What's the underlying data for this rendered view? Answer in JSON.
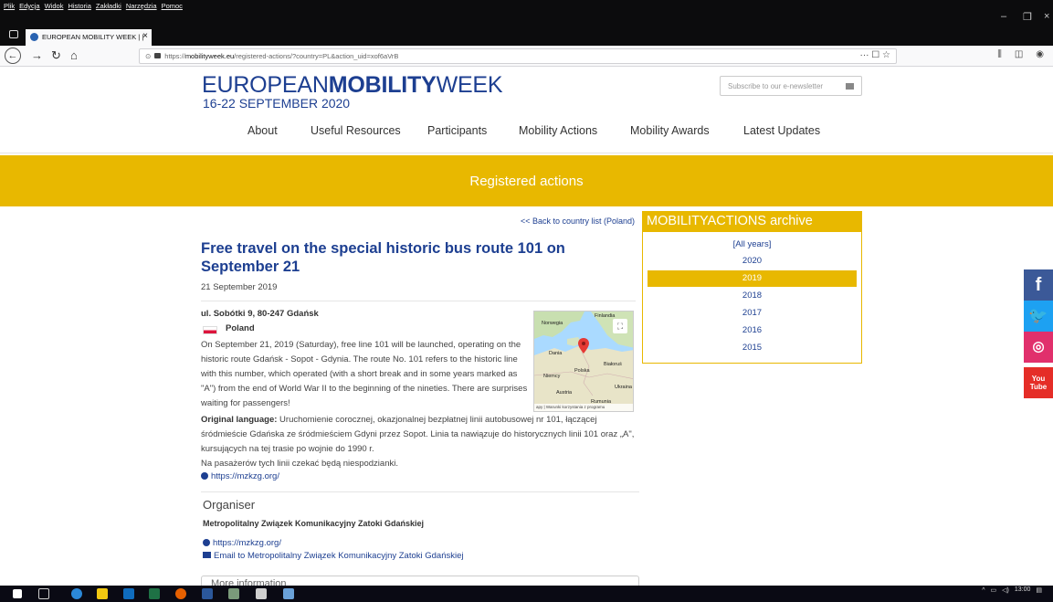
{
  "browser": {
    "menus": [
      "Plik",
      "Edycja",
      "Widok",
      "Historia",
      "Zakładki",
      "Narzędzia",
      "Pomoc"
    ],
    "tab_title": "EUROPEAN MOBILITY WEEK | |",
    "tab_close": "×",
    "url_prefix": "https://",
    "url_domain": "mobilityweek.eu",
    "url_path": "/registered-actions/?country=PL&action_uid=xof6aVrB",
    "url_actions": "··· ☐ ☆"
  },
  "site": {
    "logo_light": "EUROPEAN",
    "logo_bold": "MOBILITY",
    "logo_light2": "WEEK",
    "dates": "16-22 SEPTEMBER 2020",
    "subscribe_placeholder": "Subscribe to our e-newsletter",
    "nav": [
      "About",
      "Useful Resources",
      "Participants",
      "Mobility Actions",
      "Mobility Awards",
      "Latest Updates"
    ],
    "banner_title": "Registered actions"
  },
  "action": {
    "back_link": "<< Back to country list (Poland)",
    "title": "Free travel on the special historic bus route 101 on September 21",
    "date": "21 September 2019",
    "address": "ul. Sobótki 9, 80-247 Gdańsk",
    "country": "Poland",
    "description": "On September 21, 2019 (Saturday), free line 101 will be launched, operating on the historic route Gdańsk - Sopot - Gdynia. The route No. 101 refers to the historic line with this number, which operated (with a short break and in some years marked as \"A\") from the end of World War II to the beginning of the nineties. There are surprises waiting for passengers!",
    "original_label": "Original language:",
    "original_text": "Uruchomienie corocznej, okazjonalnej bezpłatnej linii autobusowej nr 101, łączącej śródmieście Gdańska ze śródmieściem Gdyni przez Sopot. Linia ta nawiązuje do historycznych linii 101 oraz „A\", kursujących na tej trasie po wojnie do 1990 r.",
    "original_text2": "Na pasażerów tych linii czekać będą niespodzianki.",
    "website": "https://mzkzg.org/",
    "map_labels": {
      "norwegia": "Norwegia",
      "finlandia": "Finlandia",
      "dania": "Dania",
      "polska": "Polska",
      "bialorus": "Białoruś",
      "niemcy": "Niemcy",
      "ukraina": "Ukraina",
      "austria": "Austria",
      "rumunia": "Rumunia",
      "attribution": "apy | Warunki korzystania z programu"
    }
  },
  "organiser": {
    "heading": "Organiser",
    "name": "Metropolitalny Związek Komunikacyjny Zatoki Gdańskiej",
    "website": "https://mzkzg.org/",
    "email_link": "Email to Metropolitalny Związek Komunikacyjny Zatoki Gdańskiej",
    "more_info": "More information"
  },
  "archive": {
    "heading": "MOBILITYACTIONS archive",
    "years": [
      "[All years]",
      "2020",
      "2019",
      "2018",
      "2017",
      "2016",
      "2015"
    ],
    "active_year": "2019"
  },
  "social": {
    "facebook": "f",
    "twitter": "🐦",
    "instagram": "◎",
    "youtube_top": "You",
    "youtube_bottom": "Tube"
  },
  "taskbar": {
    "time": "13:00"
  },
  "colors": {
    "brand_blue": "#1d3f91",
    "accent_yellow": "#e8b800"
  }
}
